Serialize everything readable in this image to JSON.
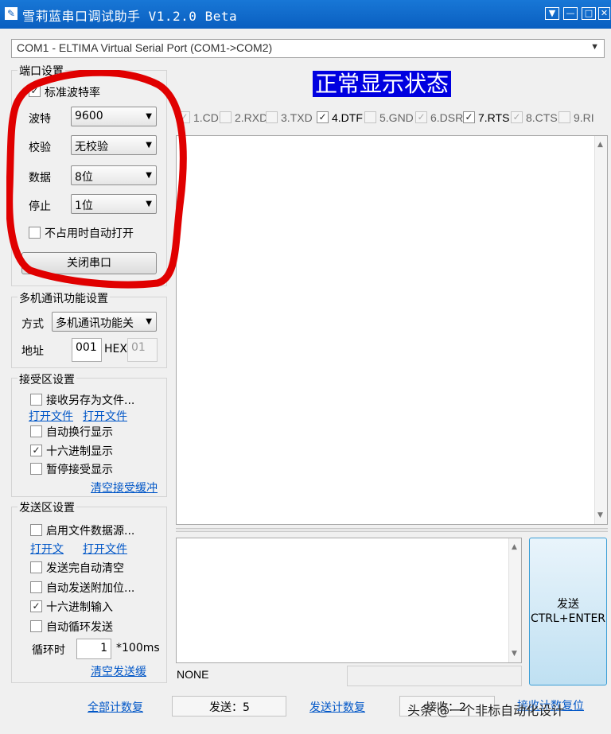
{
  "window": {
    "title": "雪莉蓝串口调试助手 V1.2.0 Beta"
  },
  "port": {
    "selected": "COM1 - ELTIMA Virtual Serial Port (COM1->COM2)"
  },
  "port_settings": {
    "title": "端口设置",
    "standard_baud": "标准波特率",
    "baud_label": "波特",
    "baud_value": "9600",
    "parity_label": "校验",
    "parity_value": "无校验",
    "databits_label": "数据",
    "databits_value": "8位",
    "stopbits_label": "停止",
    "stopbits_value": "1位",
    "auto_open": "不占用时自动打开",
    "close_port": "关闭串口"
  },
  "multi": {
    "title": "多机通讯功能设置",
    "mode_label": "方式",
    "mode_value": "多机通讯功能关",
    "addr_label": "地址",
    "addr_value": "001",
    "hex_label": "HEX",
    "hex_value": "01"
  },
  "receive": {
    "title": "接受区设置",
    "save_to_file": "接收另存为文件...",
    "open_file_1": "打开文件",
    "open_file_2": "打开文件",
    "auto_wrap": "自动换行显示",
    "hex_display": "十六进制显示",
    "pause_display": "暂停接受显示",
    "clear_buffer": "清空接受缓冲"
  },
  "send": {
    "title": "发送区设置",
    "enable_file_source": "启用文件数据源...",
    "open_file_1": "打开文",
    "open_file_2": "打开文件",
    "auto_clear": "发送完自动清空",
    "auto_append": "自动发送附加位...",
    "hex_input": "十六进制输入",
    "auto_loop": "自动循环发送",
    "loop_label": "循环时",
    "loop_value": "1",
    "loop_unit": "*100ms",
    "clear_send": "清空发送缓",
    "send_button_line1": "发送",
    "send_button_line2": "CTRL+ENTER"
  },
  "status_banner": "正常显示状态",
  "signals": [
    {
      "label": "1.CD",
      "checked": true,
      "disabled": true
    },
    {
      "label": "2.RXD",
      "checked": false,
      "disabled": true
    },
    {
      "label": "3.TXD",
      "checked": false,
      "disabled": true
    },
    {
      "label": "4.DTF",
      "checked": true,
      "disabled": false
    },
    {
      "label": "5.GND",
      "checked": false,
      "disabled": true
    },
    {
      "label": "6.DSR",
      "checked": true,
      "disabled": true
    },
    {
      "label": "7.RTS",
      "checked": true,
      "disabled": false
    },
    {
      "label": "8.CTS",
      "checked": true,
      "disabled": true
    },
    {
      "label": "9.RI",
      "checked": false,
      "disabled": true
    }
  ],
  "statusbar": {
    "none": "NONE",
    "reset_all": "全部计数复",
    "sent": "发送：5",
    "reset_sent": "发送计数复",
    "received": "接收：2",
    "reset_received": "接收计数复位"
  },
  "watermark": "头条 @一个非标自动化设计",
  "colors": {
    "title_bar": "#0a5fc0",
    "banner_bg": "#0000e0",
    "banner_fg": "#ffffff",
    "annotation_red": "#e00000",
    "link": "#0056c7"
  }
}
